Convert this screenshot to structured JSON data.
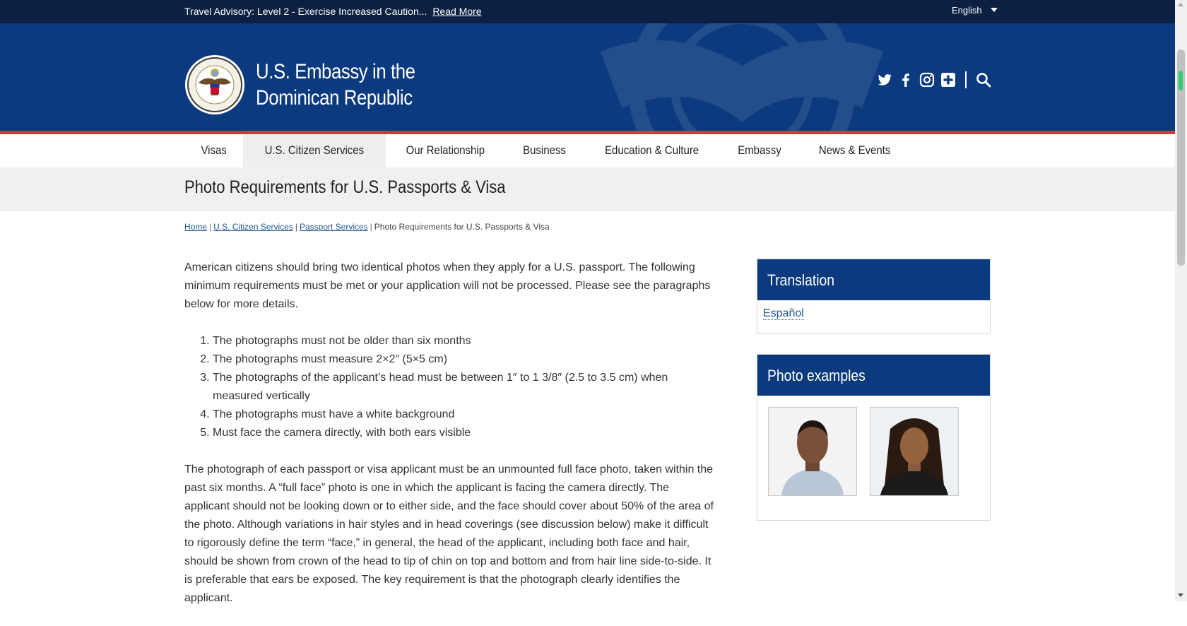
{
  "advisory": {
    "text": "Travel Advisory: Level 2 - Exercise Increased Caution...",
    "link": "Read More",
    "language": "English"
  },
  "header": {
    "title_line1": "U.S. Embassy in the",
    "title_line2": "Dominican Republic",
    "social_icons": [
      "twitter-icon",
      "facebook-icon",
      "instagram-icon",
      "plus-icon",
      "search-icon"
    ]
  },
  "nav": {
    "items": [
      "Visas",
      "U.S. Citizen Services",
      "Our Relationship",
      "Business",
      "Education & Culture",
      "Embassy",
      "News & Events"
    ],
    "active": "U.S. Citizen Services"
  },
  "page": {
    "title": "Photo Requirements for U.S. Passports & Visa"
  },
  "breadcrumb": {
    "home": "Home",
    "level1": "U.S. Citizen Services",
    "level2": "Passport Services",
    "current": "Photo Requirements for U.S. Passports & Visa"
  },
  "content": {
    "intro": "American citizens should bring two identical photos when they apply for a U.S. passport.  The following minimum requirements must be met or your application will not be processed. Please see the paragraphs below for more details.",
    "requirements": [
      "The photographs must not be older than six months",
      "The photographs must measure 2×2″ (5×5 cm)",
      "The photographs of the applicant’s head must be between 1″ to 1 3/8″ (2.5 to 3.5 cm) when measured vertically",
      "The photographs must have a white background",
      "Must face the camera directly, with both ears visible"
    ],
    "paragraph2": "The photograph of each passport or visa applicant must be an unmounted full face photo, taken within the past six months. A “full face” photo is one in which the applicant is facing the camera directly. The applicant should not be looking down or to either side, and the face should cover about 50% of the area of the photo. Although variations in hair styles and in head coverings (see discussion below) make it difficult to rigorously define the term “face,” in general, the head of the applicant, including both face and hair, should be shown from crown of the head to tip of chin on top and bottom and from hair line side-to-side. It is preferable that ears be exposed. The key requirement is that the photograph clearly identifies the applicant."
  },
  "sidebar": {
    "translation_title": "Translation",
    "translation_link": "Español",
    "photos_title": "Photo examples"
  },
  "colors": {
    "advisory_bg": "#0c2142",
    "header_bg": "#0b3a7e",
    "accent_red": "#d7353f",
    "link": "#205493"
  }
}
